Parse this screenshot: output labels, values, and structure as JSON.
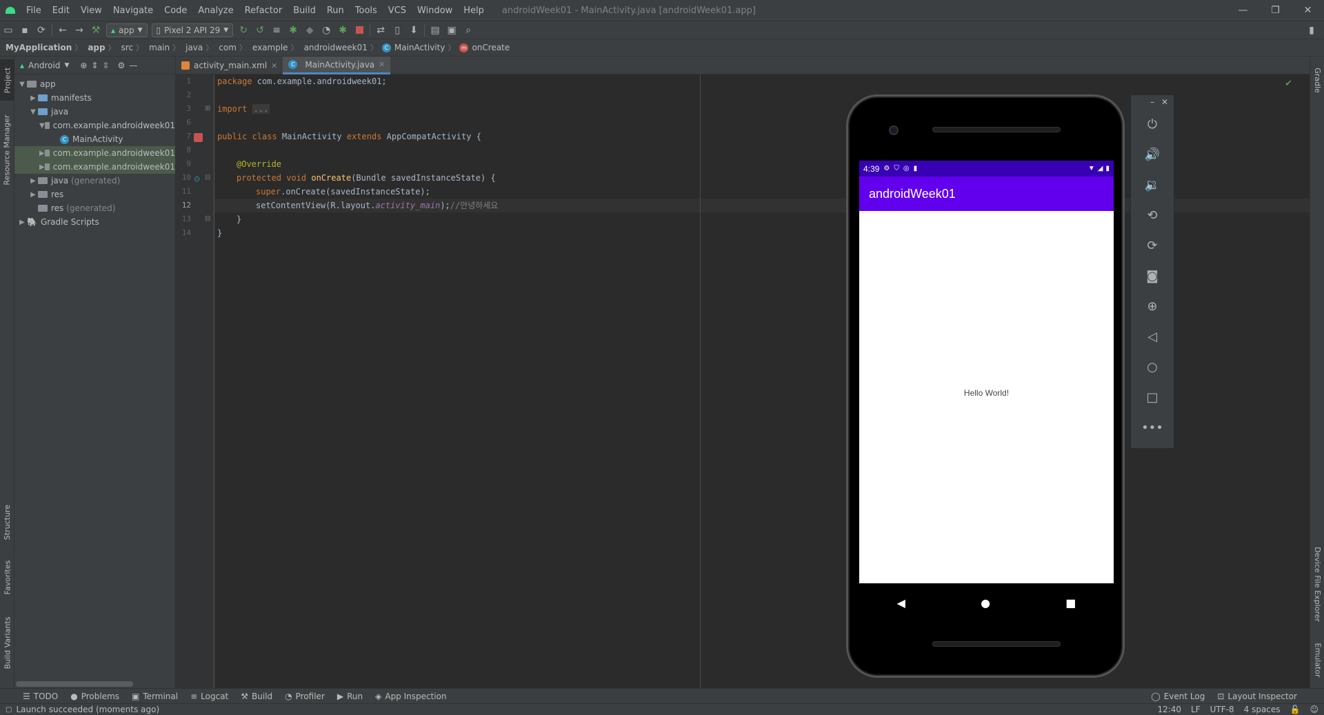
{
  "menu": {
    "items": [
      "File",
      "Edit",
      "View",
      "Navigate",
      "Code",
      "Analyze",
      "Refactor",
      "Build",
      "Run",
      "Tools",
      "VCS",
      "Window",
      "Help"
    ],
    "window_title": "androidWeek01 - MainActivity.java [androidWeek01.app]"
  },
  "toolbar": {
    "run_config": "app",
    "device": "Pixel 2 API 29"
  },
  "breadcrumbs": [
    "MyApplication",
    "app",
    "src",
    "main",
    "java",
    "com",
    "example",
    "androidweek01",
    "MainActivity",
    "onCreate"
  ],
  "project": {
    "view_mode": "Android",
    "tree": [
      {
        "label": "app",
        "indent": 0
      },
      {
        "label": "manifests",
        "indent": 1
      },
      {
        "label": "java",
        "indent": 1
      },
      {
        "label": "com.example.androidweek01",
        "indent": 2
      },
      {
        "label": "MainActivity",
        "indent": 3
      },
      {
        "label": "com.example.androidweek01",
        "indent": 2
      },
      {
        "label": "com.example.androidweek01",
        "indent": 2
      },
      {
        "label": "java",
        "suffix": "(generated)",
        "indent": 1
      },
      {
        "label": "res",
        "indent": 1
      },
      {
        "label": "res",
        "suffix": "(generated)",
        "indent": 1
      },
      {
        "label": "Gradle Scripts",
        "indent": 0
      }
    ]
  },
  "side_tabs": {
    "left": [
      "Project",
      "Resource Manager",
      "Structure",
      "Favorites",
      "Build Variants"
    ],
    "right": [
      "Gradle",
      "Device File Explorer",
      "Emulator"
    ]
  },
  "editor_tabs": [
    {
      "label": "activity_main.xml",
      "active": false
    },
    {
      "label": "MainActivity.java",
      "active": true
    }
  ],
  "code": {
    "line_numbers": [
      "1",
      "2",
      "3",
      "6",
      "7",
      "8",
      "9",
      "10",
      "11",
      "12",
      "13",
      "14"
    ],
    "pkg_kw": "package",
    "pkg_name": " com.example.androidweek01;",
    "import_kw": "import",
    "import_fold": "...",
    "class_kw1": "public class",
    "class_name": " MainActivity ",
    "class_kw2": "extends",
    "class_rest": " AppCompatActivity {",
    "annotation": "@Override",
    "method_kw": "protected void",
    "method_name": " onCreate",
    "method_rest": "(Bundle savedInstanceState) {",
    "super_kw": "super",
    "super_rest": ".onCreate(savedInstanceState);",
    "set_pre": "setContentView(R.layout.",
    "set_field": "activity_main",
    "set_post": ");",
    "set_comment": "//안녕하세요",
    "close1": "}",
    "close2": "}"
  },
  "bottom_tabs": [
    "TODO",
    "Problems",
    "Terminal",
    "Logcat",
    "Build",
    "Profiler",
    "Run",
    "App Inspection"
  ],
  "bottom_right_tabs": [
    "Event Log",
    "Layout Inspector"
  ],
  "status": {
    "message": "Launch succeeded (moments ago)",
    "position": "12:40",
    "line_sep": "LF",
    "encoding": "UTF-8",
    "indent": "4 spaces"
  },
  "emulator": {
    "time": "4:39",
    "app_title": "androidWeek01",
    "content_text": "Hello World!",
    "buttons": [
      "power-icon",
      "volume-up-icon",
      "volume-down-icon",
      "rotate-left-icon",
      "rotate-right-icon",
      "camera-icon",
      "zoom-icon",
      "back-icon",
      "home-icon",
      "overview-icon",
      "more-icon"
    ]
  },
  "colors": {
    "status_bar": "#3700b3",
    "app_bar": "#6200ee",
    "ide_bg": "#2b2b2b",
    "panel_bg": "#3c3f41"
  }
}
